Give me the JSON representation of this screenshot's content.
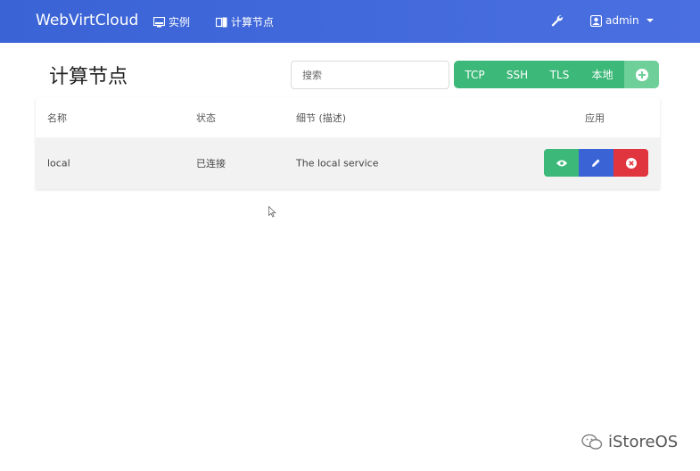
{
  "navbar": {
    "brand": "WebVirtCloud",
    "items": [
      {
        "label": "实例",
        "icon": "monitor-icon"
      },
      {
        "label": "计算节点",
        "icon": "server-icon"
      }
    ],
    "settings_icon": "wrench-icon",
    "user": {
      "label": "admin",
      "icon": "user-icon"
    }
  },
  "page": {
    "title": "计算节点",
    "search": {
      "placeholder": "搜索",
      "value": ""
    },
    "connection_buttons": [
      "TCP",
      "SSH",
      "TLS",
      "本地"
    ],
    "add_icon": "plus-circle-icon"
  },
  "table": {
    "headers": [
      "名称",
      "状态",
      "细节 (描述)",
      "应用"
    ],
    "rows": [
      {
        "name": "local",
        "status": "已连接",
        "details": "The local service",
        "actions": [
          "eye-icon",
          "pencil-icon",
          "x-circle-icon"
        ]
      }
    ]
  },
  "colors": {
    "navbar": "#3a63d6",
    "success": "#3cb878",
    "primary": "#3a63d6",
    "danger": "#e0343f"
  },
  "watermark": {
    "label": "iStoreOS",
    "icon": "wechat-icon"
  }
}
